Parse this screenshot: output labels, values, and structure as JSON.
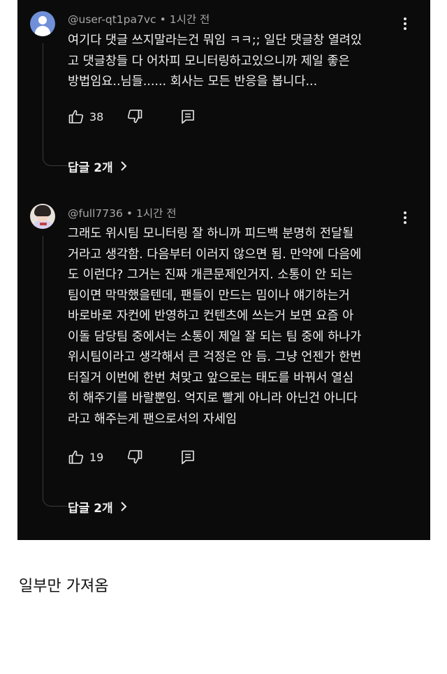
{
  "comments": [
    {
      "author": "@user-qt1pa7vc",
      "time": "1시간 전",
      "lines": [
        "여기다 댓글 쓰지말라는건 뭐임 ㅋㅋ;; 일단 댓글창 열려있",
        "고 댓글창들 다 어차피 모니터링하고있으니까 제일 좋은",
        "방법임요..님들...... 회사는 모든 반응을 봅니다..."
      ],
      "likes": "38",
      "replies_label": "답글 2개"
    },
    {
      "author": "@full7736",
      "time": "1시간 전",
      "lines": [
        "그래도 위시팀 모니터링 잘 하니까 피드백 분명히 전달될",
        "거라고 생각함. 다음부터 이러지 않으면 됨. 만약에 다음에",
        "도 이런다? 그거는 진짜 개큰문제인거지. 소통이 안 되는",
        "팀이면 막막했을텐데, 팬들이 만드는 밈이나 얘기하는거",
        "바로바로 자컨에 반영하고 컨텐츠에 쓰는거 보면 요즘 아",
        "이돌 담당팀 중에서는 소통이 제일 잘 되는 팀 중에 하나가",
        "위시팀이라고 생각해서 큰 걱정은 안 듬. 그냥 언젠가 한번",
        "터질거 이번에 한번 쳐맞고 앞으로는 태도를 바꿔서 열심",
        "히 해주기를 바랄뿐임. 억지로 빨게 아니라 아닌건 아니다",
        "라고 해주는게 팬으로서의 자세임"
      ],
      "likes": "19",
      "replies_label": "답글 2개"
    }
  ],
  "caption": "일부만 가져옴",
  "colors": {
    "panel_bg": "#0b0b0b",
    "text": "#f1f1f1",
    "meta": "#a7a7a7",
    "page_bg": "#ffffff"
  },
  "icons": {
    "like": "thumbs-up-icon",
    "dislike": "thumbs-down-icon",
    "reply": "reply-comment-icon",
    "menu": "more-vert-icon",
    "expand": "chevron-right-icon",
    "default_avatar": "user-avatar-icon"
  }
}
